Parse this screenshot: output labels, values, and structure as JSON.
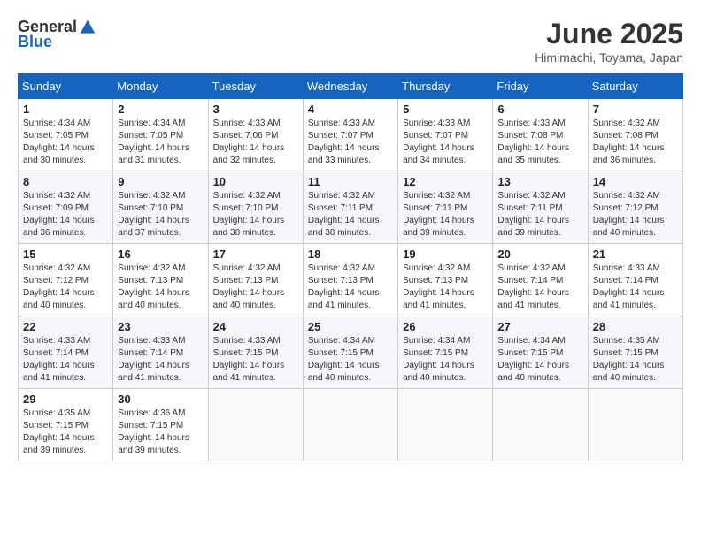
{
  "header": {
    "logo_general": "General",
    "logo_blue": "Blue",
    "title": "June 2025",
    "location": "Himimachi, Toyama, Japan"
  },
  "calendar": {
    "days_of_week": [
      "Sunday",
      "Monday",
      "Tuesday",
      "Wednesday",
      "Thursday",
      "Friday",
      "Saturday"
    ],
    "weeks": [
      [
        null,
        {
          "day": "2",
          "sunrise": "4:34 AM",
          "sunset": "7:05 PM",
          "daylight": "14 hours and 31 minutes."
        },
        {
          "day": "3",
          "sunrise": "4:33 AM",
          "sunset": "7:06 PM",
          "daylight": "14 hours and 32 minutes."
        },
        {
          "day": "4",
          "sunrise": "4:33 AM",
          "sunset": "7:07 PM",
          "daylight": "14 hours and 33 minutes."
        },
        {
          "day": "5",
          "sunrise": "4:33 AM",
          "sunset": "7:07 PM",
          "daylight": "14 hours and 34 minutes."
        },
        {
          "day": "6",
          "sunrise": "4:33 AM",
          "sunset": "7:08 PM",
          "daylight": "14 hours and 35 minutes."
        },
        {
          "day": "7",
          "sunrise": "4:32 AM",
          "sunset": "7:08 PM",
          "daylight": "14 hours and 36 minutes."
        }
      ],
      [
        {
          "day": "1",
          "sunrise": "4:34 AM",
          "sunset": "7:05 PM",
          "daylight": "14 hours and 30 minutes."
        },
        {
          "day": "9",
          "sunrise": "4:32 AM",
          "sunset": "7:10 PM",
          "daylight": "14 hours and 37 minutes."
        },
        {
          "day": "10",
          "sunrise": "4:32 AM",
          "sunset": "7:10 PM",
          "daylight": "14 hours and 38 minutes."
        },
        {
          "day": "11",
          "sunrise": "4:32 AM",
          "sunset": "7:11 PM",
          "daylight": "14 hours and 38 minutes."
        },
        {
          "day": "12",
          "sunrise": "4:32 AM",
          "sunset": "7:11 PM",
          "daylight": "14 hours and 39 minutes."
        },
        {
          "day": "13",
          "sunrise": "4:32 AM",
          "sunset": "7:11 PM",
          "daylight": "14 hours and 39 minutes."
        },
        {
          "day": "14",
          "sunrise": "4:32 AM",
          "sunset": "7:12 PM",
          "daylight": "14 hours and 40 minutes."
        }
      ],
      [
        {
          "day": "8",
          "sunrise": "4:32 AM",
          "sunset": "7:09 PM",
          "daylight": "14 hours and 36 minutes."
        },
        {
          "day": "16",
          "sunrise": "4:32 AM",
          "sunset": "7:13 PM",
          "daylight": "14 hours and 40 minutes."
        },
        {
          "day": "17",
          "sunrise": "4:32 AM",
          "sunset": "7:13 PM",
          "daylight": "14 hours and 40 minutes."
        },
        {
          "day": "18",
          "sunrise": "4:32 AM",
          "sunset": "7:13 PM",
          "daylight": "14 hours and 41 minutes."
        },
        {
          "day": "19",
          "sunrise": "4:32 AM",
          "sunset": "7:13 PM",
          "daylight": "14 hours and 41 minutes."
        },
        {
          "day": "20",
          "sunrise": "4:32 AM",
          "sunset": "7:14 PM",
          "daylight": "14 hours and 41 minutes."
        },
        {
          "day": "21",
          "sunrise": "4:33 AM",
          "sunset": "7:14 PM",
          "daylight": "14 hours and 41 minutes."
        }
      ],
      [
        {
          "day": "15",
          "sunrise": "4:32 AM",
          "sunset": "7:12 PM",
          "daylight": "14 hours and 40 minutes."
        },
        {
          "day": "23",
          "sunrise": "4:33 AM",
          "sunset": "7:14 PM",
          "daylight": "14 hours and 41 minutes."
        },
        {
          "day": "24",
          "sunrise": "4:33 AM",
          "sunset": "7:15 PM",
          "daylight": "14 hours and 41 minutes."
        },
        {
          "day": "25",
          "sunrise": "4:34 AM",
          "sunset": "7:15 PM",
          "daylight": "14 hours and 40 minutes."
        },
        {
          "day": "26",
          "sunrise": "4:34 AM",
          "sunset": "7:15 PM",
          "daylight": "14 hours and 40 minutes."
        },
        {
          "day": "27",
          "sunrise": "4:34 AM",
          "sunset": "7:15 PM",
          "daylight": "14 hours and 40 minutes."
        },
        {
          "day": "28",
          "sunrise": "4:35 AM",
          "sunset": "7:15 PM",
          "daylight": "14 hours and 40 minutes."
        }
      ],
      [
        {
          "day": "22",
          "sunrise": "4:33 AM",
          "sunset": "7:14 PM",
          "daylight": "14 hours and 41 minutes."
        },
        {
          "day": "30",
          "sunrise": "4:36 AM",
          "sunset": "7:15 PM",
          "daylight": "14 hours and 39 minutes."
        },
        null,
        null,
        null,
        null,
        null
      ],
      [
        {
          "day": "29",
          "sunrise": "4:35 AM",
          "sunset": "7:15 PM",
          "daylight": "14 hours and 39 minutes."
        },
        null,
        null,
        null,
        null,
        null,
        null
      ]
    ]
  }
}
